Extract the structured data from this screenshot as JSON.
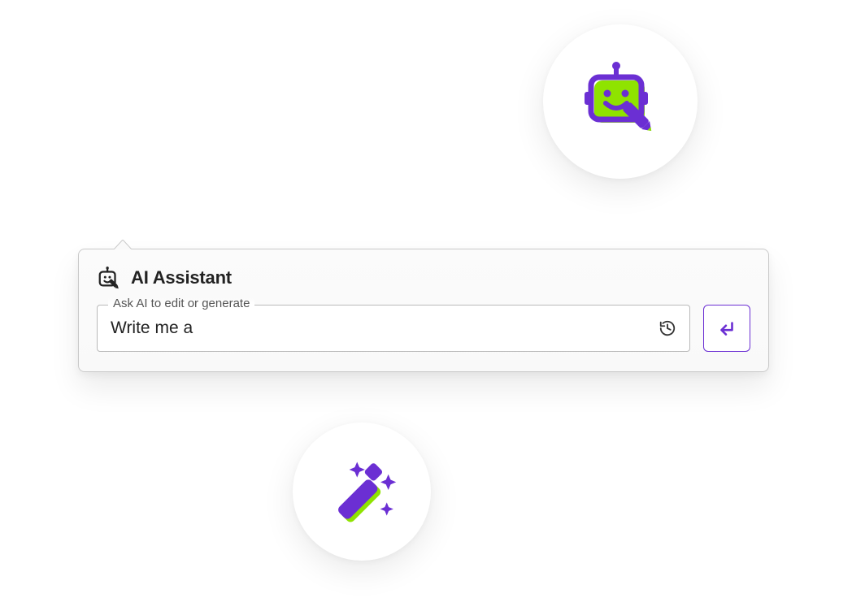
{
  "colors": {
    "accent_purple": "#6b2fd3",
    "accent_green": "#8fe300"
  },
  "badges": {
    "robot": "ai-robot-icon",
    "wand": "magic-wand-icon"
  },
  "panel": {
    "title": "AI Assistant",
    "input": {
      "label": "Ask AI to edit or generate",
      "value": "Write me a"
    }
  }
}
